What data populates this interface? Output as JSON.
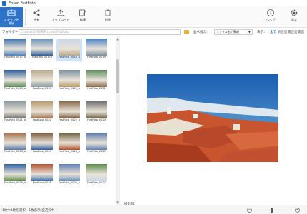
{
  "window": {
    "title": "Epson FastFoto"
  },
  "toolbar": {
    "scan": "スキャンを\n開始",
    "share": "共有",
    "upload": "アップロード",
    "edit": "編集",
    "delete": "削除",
    "help": "ヘルプ",
    "settings": "設定"
  },
  "pathbar": {
    "label": "フォルダー：",
    "path": "C:\\Users\\EPSON\\Pictures\\FastFoto",
    "sort_label": "並べ替え：",
    "sort_value": "ファイル名 / 昇順",
    "view_label": "表示：",
    "view_options": [
      "全て",
      "表正面",
      "裏正面",
      "裏面"
    ]
  },
  "thumbnails": [
    "FastFoto_0017_a",
    "FastFoto_0017B",
    "FastFoto_0018_a",
    "FastFoto_0019",
    "FastFoto_0019_a",
    "FastFoto_0020",
    "FastFoto_0020_a",
    "FastFoto_0021",
    "FastFoto_0021_a",
    "FastFoto_0022",
    "FastFoto_0022_a",
    "FastFoto_0023",
    "FastFoto_0023_a",
    "FastFoto_0024",
    "FastFoto_0024_a",
    "FastFoto_0025",
    "FastFoto_0025_a",
    "FastFoto_0026",
    "FastFoto_0026_a",
    "FastFoto_0027"
  ],
  "thumb_colors": [
    "#3a6ea8",
    "#6a8fb8",
    "#c9d6e6",
    "#4a80c0",
    "#2a5d9c",
    "#b8a88a",
    "#7a8fa0",
    "#5a8a5a",
    "#8a9aa0",
    "#b89a6a",
    "#8a6a4a",
    "#707070",
    "#a07050",
    "#7a5a40",
    "#6a6040",
    "#5a7aa8",
    "#3060a0",
    "#b05030",
    "#6080b0",
    "#5a8a4a"
  ],
  "preview": {
    "caption_label": "撮影日："
  },
  "status": {
    "text": "1枚中1枚を選択、1枚表示/全選択中"
  }
}
